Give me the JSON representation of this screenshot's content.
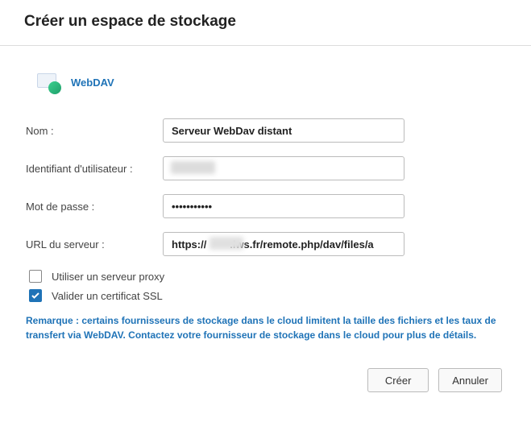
{
  "header": {
    "title": "Créer un espace de stockage"
  },
  "provider": {
    "name": "WebDAV"
  },
  "form": {
    "name": {
      "label": "Nom :",
      "value": "Serveur WebDav distant"
    },
    "userId": {
      "label": "Identifiant d'utilisateur :",
      "value": ""
    },
    "password": {
      "label": "Mot de passe :",
      "value": "•••••••••••"
    },
    "serverUrl": {
      "label": "URL du serveur :",
      "value": "https://        .lws.fr/remote.php/dav/files/a"
    },
    "proxy": {
      "label": "Utiliser un serveur proxy",
      "checked": false
    },
    "ssl": {
      "label": "Valider un certificat SSL",
      "checked": true
    }
  },
  "note": "Remarque : certains fournisseurs de stockage dans le cloud limitent la taille des fichiers et les taux de transfert via WebDAV. Contactez votre fournisseur de stockage dans le cloud pour plus de détails.",
  "buttons": {
    "create": "Créer",
    "cancel": "Annuler"
  }
}
